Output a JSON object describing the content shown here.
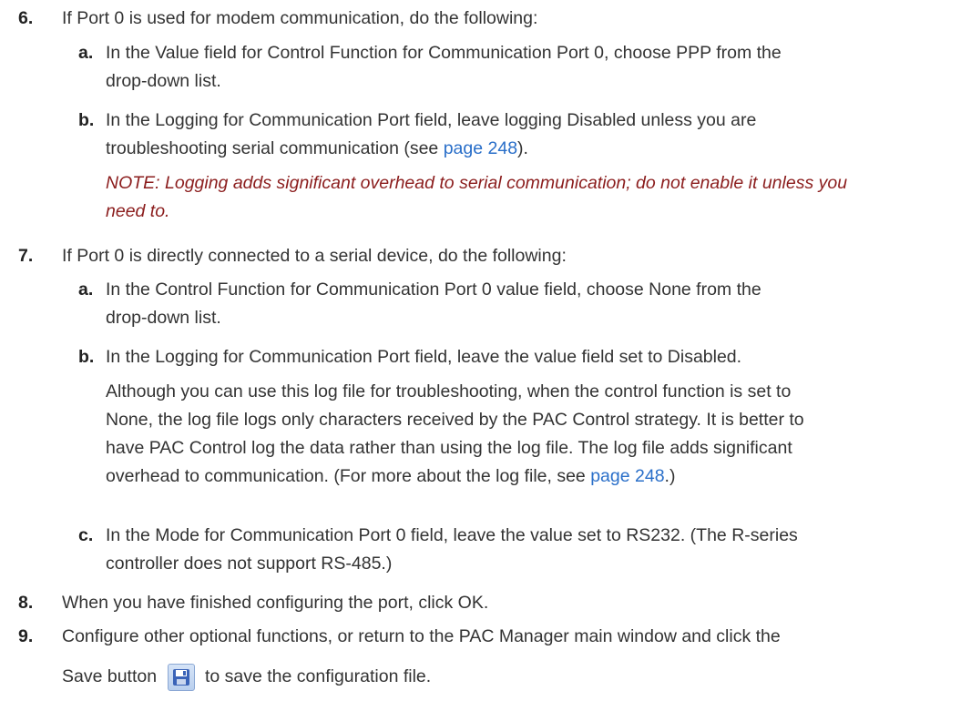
{
  "steps": [
    {
      "num": "6.",
      "text": "If Port 0 is used for modem communication, do the following:",
      "subs": [
        {
          "letter": "a.",
          "line1": "In the Value field for Control Function for Communication Port 0, choose PPP from the",
          "line2": "drop-down list."
        },
        {
          "letter": "b.",
          "line1": "In the Logging for Communication Port field, leave logging Disabled unless you are",
          "line2_pre": "troubleshooting serial communication (see ",
          "link": "page 248",
          "line2_post": ").",
          "note1": "NOTE: Logging adds significant overhead to serial communication; do not enable it unless you",
          "note2": "need to."
        }
      ]
    },
    {
      "num": "7.",
      "text": "If Port 0 is directly connected to a serial device, do the following:",
      "subs": [
        {
          "letter": "a.",
          "line1": "In the Control Function for Communication Port 0 value field, choose None from the",
          "line2": "drop-down list."
        },
        {
          "letter": "b.",
          "line1": "In the Logging for Communication Port field, leave the value field set to Disabled.",
          "para1": "Although you can use this log file for troubleshooting, when the control function is set to",
          "para2": "None, the log file logs only characters received by the PAC Control strategy. It is better to",
          "para3": "have PAC Control log the data rather than using the log file. The log file adds significant",
          "para4_pre": "overhead to communication. (For more about the log file, see ",
          "link": "page 248",
          "para4_post": ".)"
        },
        {
          "letter": "c.",
          "line1": "In the Mode for Communication Port 0 field, leave the value set to RS232. (The R-series",
          "line2": "controller does not support RS-485.)"
        }
      ]
    },
    {
      "num": "8.",
      "text": "When you have finished configuring the port, click OK."
    },
    {
      "num": "9.",
      "text": "Configure other optional functions, or return to the PAC Manager main window and click the",
      "line2_pre": "Save button",
      "icon": "save-disk-icon",
      "line2_post": "to save the configuration file."
    }
  ]
}
